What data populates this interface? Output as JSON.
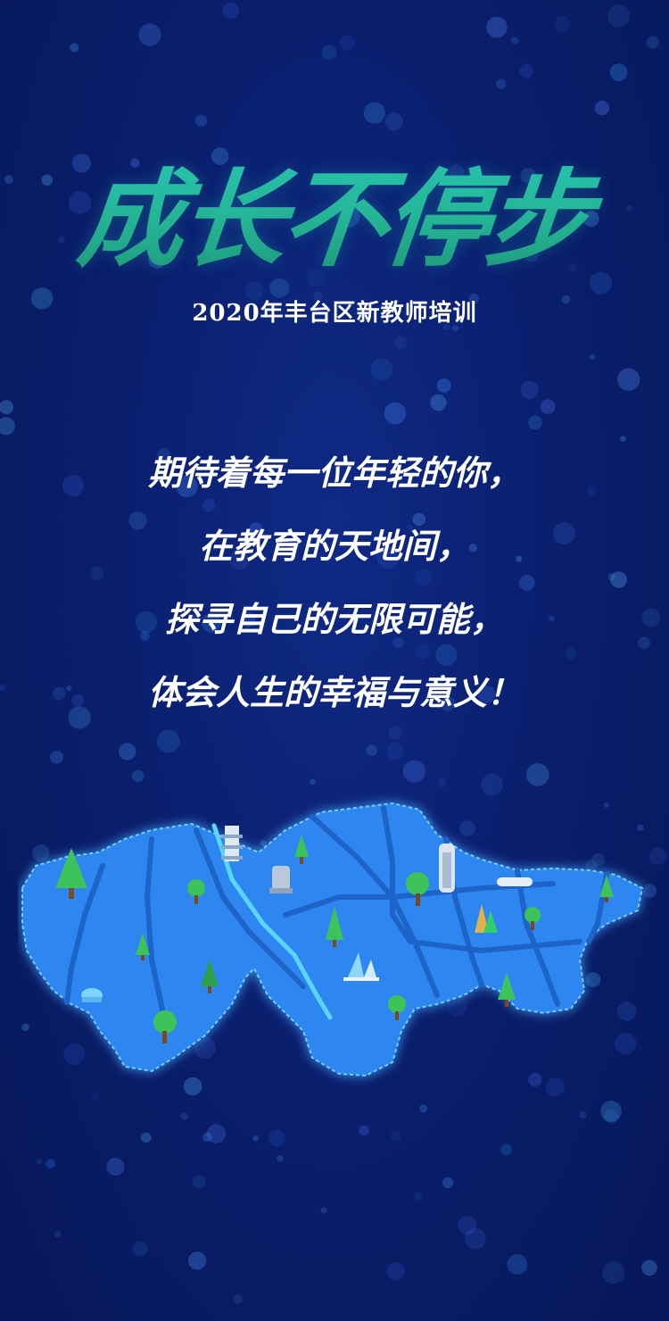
{
  "header": {
    "title": "成长不停步",
    "subtitle": "2020年丰台区新教师培训"
  },
  "message": {
    "lines": [
      "期待着每一位年轻的你，",
      "在教育的天地间，",
      "探寻自己的无限可能，",
      "体会人生的幸福与意义！"
    ]
  },
  "colors": {
    "background": "#0a1f6e",
    "title_gradient": "#2ac7b8",
    "map_fill": "#2f86f0",
    "map_glow": "#5cc6ff",
    "text": "#ffffff"
  },
  "map": {
    "icons": [
      "tree-icon",
      "pagoda-icon",
      "statue-icon",
      "tower-building-icon",
      "sculpture-icon",
      "train-icon",
      "water-fountain-icon",
      "sail-sculpture-icon"
    ]
  }
}
